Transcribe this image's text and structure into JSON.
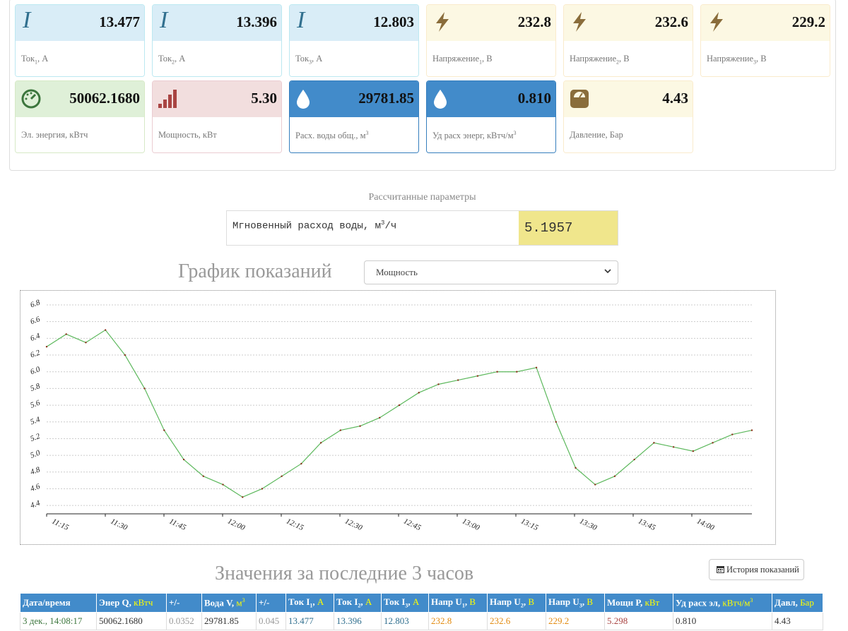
{
  "cards_row1": [
    {
      "value": "13.477",
      "label": "Ток",
      "sub": "1",
      "unit": ", А"
    },
    {
      "value": "13.396",
      "label": "Ток",
      "sub": "2",
      "unit": ", А"
    },
    {
      "value": "12.803",
      "label": "Ток",
      "sub": "3",
      "unit": ", А"
    },
    {
      "value": "232.8",
      "label": "Напряжение",
      "sub": "1",
      "unit": ", В"
    },
    {
      "value": "232.6",
      "label": "Напряжение",
      "sub": "2",
      "unit": ", В"
    },
    {
      "value": "229.2",
      "label": "Напряжение",
      "sub": "3",
      "unit": ", В"
    }
  ],
  "cards_row2": [
    {
      "value": "50062.1680",
      "label": "Эл. энергия, кВтч"
    },
    {
      "value": "5.30",
      "label": "Мощность, кВт"
    },
    {
      "value": "29781.85",
      "label": "Расх. воды общ., м",
      "sup": "3"
    },
    {
      "value": "0.810",
      "label": "Уд расх энерг, кВтч/м",
      "sup": "3"
    },
    {
      "value": "4.43",
      "label": "Давление, Бар"
    }
  ],
  "icons": {
    "current": "I",
    "voltage": "bolt-icon",
    "energy": "gauge-icon",
    "power": "signal-bars-icon",
    "water": "water-drop-icon",
    "pressure": "pressure-gauge-icon"
  },
  "calc": {
    "title": "Рассчитанные параметры",
    "label": "Мгновенный расход воды, м",
    "label_sup": "3",
    "label_tail": "/ч",
    "value": "5.1957"
  },
  "chart_section": {
    "title": "График показаний",
    "selected": "Мощность"
  },
  "chart_data": {
    "type": "line",
    "x_tick_labels": [
      "11:15",
      "11:30",
      "11:45",
      "12:00",
      "12:15",
      "12:30",
      "12:45",
      "13:00",
      "13:15",
      "13:30",
      "13:45",
      "14:00"
    ],
    "y_tick_labels": [
      "4.4",
      "4.6",
      "4.8",
      "5.0",
      "5.2",
      "5.4",
      "5.6",
      "5.8",
      "6.0",
      "6.2",
      "6.4",
      "6.6",
      "6.8"
    ],
    "ylim": [
      4.3,
      6.8
    ],
    "xlim_minutes": [
      0,
      180
    ],
    "grid": true,
    "line_color": "#5cb85c",
    "point_color": "#8b2f1a",
    "x_minutes": [
      0,
      5,
      10,
      15,
      20,
      25,
      30,
      35,
      40,
      45,
      50,
      55,
      60,
      65,
      70,
      75,
      80,
      85,
      90,
      95,
      100,
      105,
      110,
      115,
      120,
      125,
      130,
      135,
      140,
      145,
      150,
      155,
      160,
      165,
      170,
      175,
      180
    ],
    "values": [
      6.3,
      6.45,
      6.35,
      6.5,
      6.2,
      5.8,
      5.3,
      4.95,
      4.75,
      4.65,
      4.5,
      4.6,
      4.75,
      4.9,
      5.15,
      5.3,
      5.35,
      5.45,
      5.6,
      5.75,
      5.85,
      5.9,
      5.95,
      6.0,
      6.0,
      6.05,
      5.4,
      4.85,
      4.65,
      4.75,
      4.95,
      5.15,
      5.1,
      5.05,
      5.15,
      5.25,
      5.3
    ]
  },
  "table": {
    "title": "Значения за последние 3 часов",
    "history_button": "История показаний",
    "headers": [
      {
        "text": "Дата/время"
      },
      {
        "text": "Энер Q, ",
        "unit": "кВтч"
      },
      {
        "text": "+/-"
      },
      {
        "text": "Вода V, ",
        "unit": "м",
        "unit_sup": "3"
      },
      {
        "text": "+/-"
      },
      {
        "text": "Ток I",
        "sub": "1",
        "tail": ", ",
        "unit": "А"
      },
      {
        "text": "Ток I",
        "sub": "2",
        "tail": ", ",
        "unit": "А"
      },
      {
        "text": "Ток I",
        "sub": "3",
        "tail": ", ",
        "unit": "А"
      },
      {
        "text": "Напр U",
        "sub": "1",
        "tail": ", ",
        "unit": "В"
      },
      {
        "text": "Напр U",
        "sub": "2",
        "tail": ", ",
        "unit": "В"
      },
      {
        "text": "Напр U",
        "sub": "3",
        "tail": ", ",
        "unit": "В"
      },
      {
        "text": "Мощн P, ",
        "unit": "кВт"
      },
      {
        "text": "Уд расх эл, ",
        "unit": "кВтч/м",
        "unit_sup": "3"
      },
      {
        "text": "Давл, ",
        "unit": "Бар"
      }
    ],
    "row": [
      "3 дек., 14:08:17",
      "50062.1680",
      "0.0352",
      "29781.85",
      "0.045",
      "13.477",
      "13.396",
      "12.803",
      "232.8",
      "232.6",
      "229.2",
      "5.298",
      "0.810",
      "4.43"
    ]
  }
}
